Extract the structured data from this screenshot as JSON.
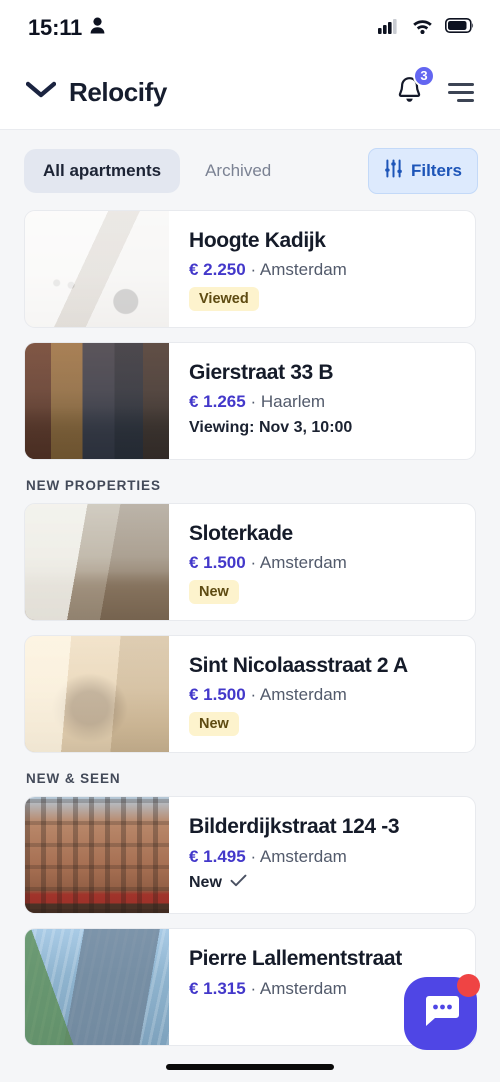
{
  "status_bar": {
    "time": "15:11",
    "profile_icon": "person-icon",
    "signal_icon": "cellular-signal-icon",
    "wifi_icon": "wifi-icon",
    "battery_icon": "battery-icon"
  },
  "header": {
    "logo_icon": "chevron-down-logo-icon",
    "brand": "Relocify",
    "notifications": {
      "icon": "bell-icon",
      "count": "3",
      "badge_color": "#6366f1"
    },
    "menu_icon": "hamburger-menu-icon"
  },
  "tabs": {
    "items": [
      {
        "label": "All apartments",
        "active": true
      },
      {
        "label": "Archived",
        "active": false
      }
    ],
    "filters": {
      "label": "Filters",
      "icon": "sliders-icon",
      "text_color": "#1d55b8",
      "bg_color": "#ddeafd"
    }
  },
  "sections": [
    {
      "label": "",
      "cards": [
        {
          "title": "Hoogte Kadijk",
          "price": "€ 2.250",
          "separator": " · ",
          "city": "Amsterdam",
          "badge": "Viewed",
          "badge_type": "pill",
          "thumb_class": "th-1"
        },
        {
          "title": "Gierstraat 33 B",
          "price": "€ 1.265",
          "separator": " · ",
          "city": "Haarlem",
          "meta": "Viewing: Nov 3, 10:00",
          "badge_type": "meta",
          "thumb_class": "th-2"
        }
      ]
    },
    {
      "label": "NEW PROPERTIES",
      "cards": [
        {
          "title": "Sloterkade",
          "price": "€ 1.500",
          "separator": " · ",
          "city": "Amsterdam",
          "badge": "New",
          "badge_type": "pill",
          "thumb_class": "th-3"
        },
        {
          "title": "Sint Nicolaasstraat 2 A",
          "price": "€ 1.500",
          "separator": " · ",
          "city": "Amsterdam",
          "badge": "New",
          "badge_type": "pill",
          "thumb_class": "th-4"
        }
      ]
    },
    {
      "label": "NEW & SEEN",
      "cards": [
        {
          "title": "Bilderdijkstraat 124 -3",
          "price": "€ 1.495",
          "separator": " · ",
          "city": "Amsterdam",
          "badge": "New",
          "badge_type": "check",
          "check_icon": "checkmark-icon",
          "thumb_class": "th-5"
        },
        {
          "title": "Pierre Lallementstraat",
          "price": "€ 1.315",
          "separator": " · ",
          "city": "Amsterdam",
          "badge_type": "none",
          "thumb_class": "th-6"
        }
      ]
    }
  ],
  "fab": {
    "icon": "chat-bubble-icon",
    "color": "#4f46e5",
    "dot_icon": "unread-dot-icon",
    "dot_color": "#ef4444"
  },
  "home_indicator": "home-indicator"
}
